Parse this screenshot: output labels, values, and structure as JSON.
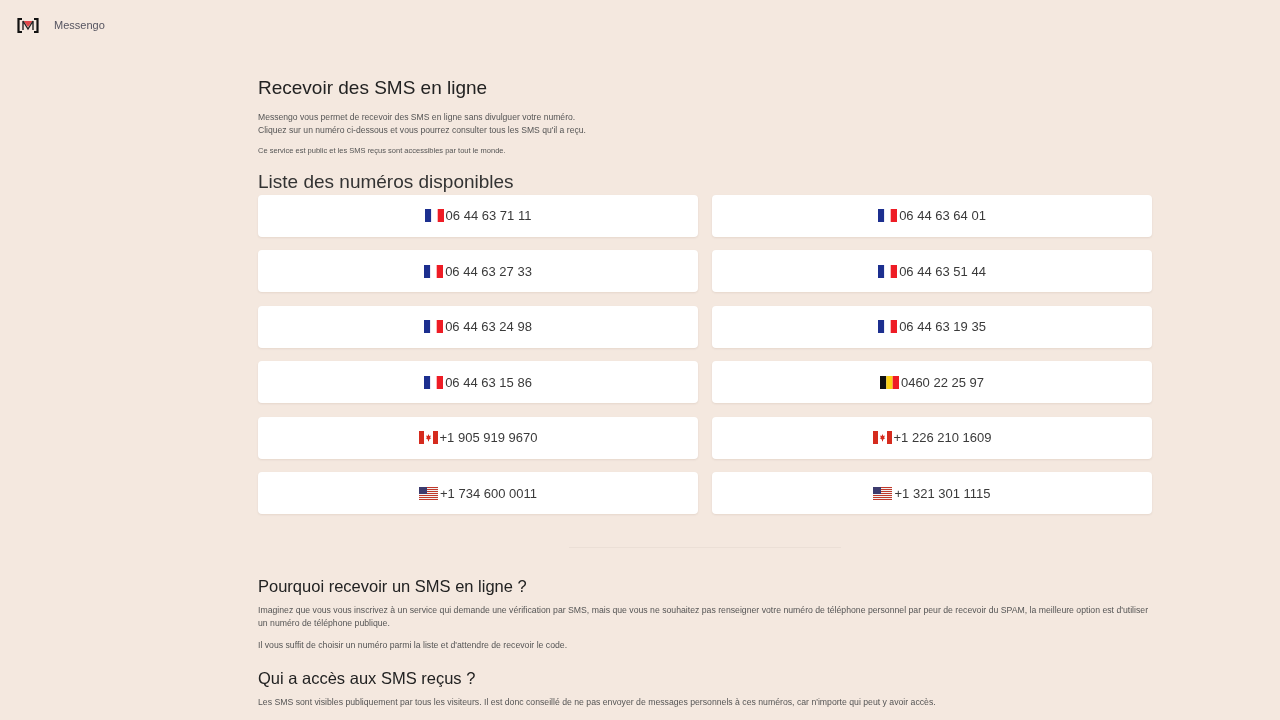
{
  "header": {
    "brand": "Messengo"
  },
  "intro": {
    "title": "Recevoir des SMS en ligne",
    "lines": [
      "Messengo vous permet de recevoir des SMS en ligne sans divulguer votre numéro.",
      "Cliquez sur un numéro ci-dessous et vous pourrez consulter tous les SMS qu'il a reçu."
    ],
    "note": "Ce service est public et les SMS reçus sont accessibles par tout le monde."
  },
  "numbers": {
    "title": "Liste des numéros disponibles",
    "items": [
      {
        "kind": "fr",
        "number": "06 44 63 71 11"
      },
      {
        "kind": "fr",
        "number": "06 44 63 64 01"
      },
      {
        "kind": "fr",
        "number": "06 44 63 27 33"
      },
      {
        "kind": "fr",
        "number": "06 44 63 51 44"
      },
      {
        "kind": "fr",
        "number": "06 44 63 24 98"
      },
      {
        "kind": "fr",
        "number": "06 44 63 19 35"
      },
      {
        "kind": "fr",
        "number": "06 44 63 15 86"
      },
      {
        "kind": "be",
        "number": "0460 22 25 97"
      },
      {
        "kind": "ca",
        "number": "+1 905 919 9670"
      },
      {
        "kind": "ca",
        "number": "+1 226 210 1609"
      },
      {
        "kind": "us",
        "number": "+1 734 600 0011"
      },
      {
        "kind": "us",
        "number": "+1 321 301 1115"
      }
    ]
  },
  "sections": [
    {
      "title": "Pourquoi recevoir un SMS en ligne ?",
      "paragraphs": [
        "Imaginez que vous vous inscrivez à un service qui demande une vérification par SMS, mais que vous ne souhaitez pas renseigner votre numéro de téléphone personnel par peur de recevoir du SPAM, la meilleure option est d'utiliser un numéro de téléphone publique.",
        "Il vous suffit de choisir un numéro parmi la liste et d'attendre de recevoir le code."
      ]
    },
    {
      "title": "Qui a accès aux SMS reçus ?",
      "paragraphs": [
        "Les SMS sont visibles publiquement par tous les visiteurs. Il est donc conseillé de ne pas envoyer de messages personnels à ces numéros, car n'importe qui peut y avoir accès."
      ]
    }
  ]
}
